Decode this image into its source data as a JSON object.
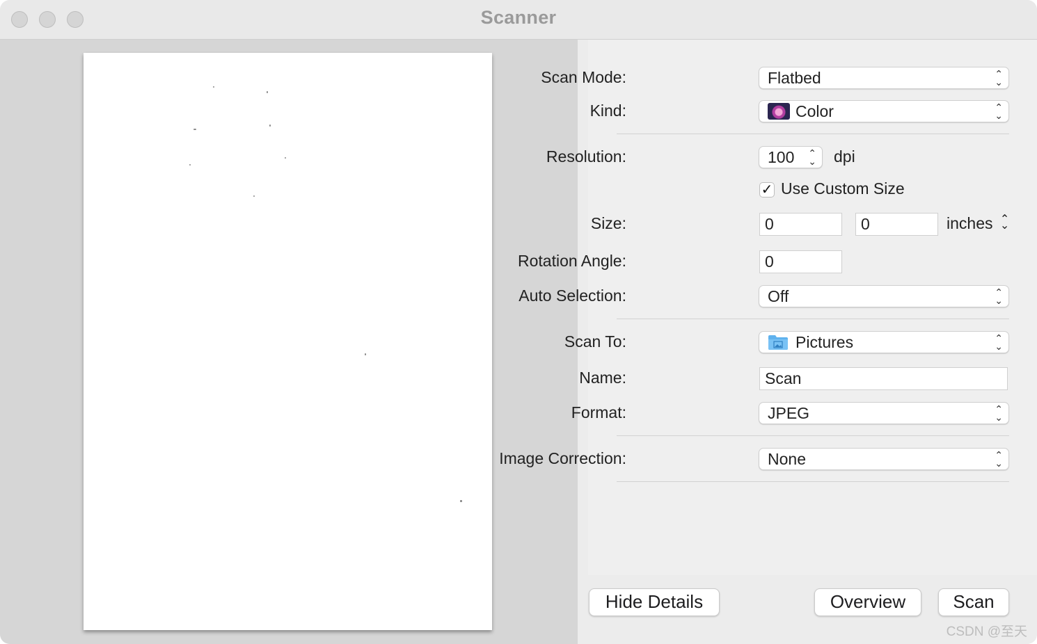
{
  "window": {
    "title": "Scanner"
  },
  "settings": {
    "scan_mode": {
      "label": "Scan Mode:",
      "value": "Flatbed"
    },
    "kind": {
      "label": "Kind:",
      "value": "Color",
      "icon": "color-flower-icon"
    },
    "resolution": {
      "label": "Resolution:",
      "value": "100",
      "unit": "dpi"
    },
    "use_custom_size": {
      "label": "Use Custom Size",
      "checked": true,
      "mark": "✓"
    },
    "size": {
      "label": "Size:",
      "width": "0",
      "height": "0",
      "unit": "inches"
    },
    "rotation_angle": {
      "label": "Rotation Angle:",
      "value": "0"
    },
    "auto_selection": {
      "label": "Auto Selection:",
      "value": "Off"
    },
    "scan_to": {
      "label": "Scan To:",
      "value": "Pictures",
      "icon": "pictures-folder-icon"
    },
    "name": {
      "label": "Name:",
      "value": "Scan"
    },
    "format": {
      "label": "Format:",
      "value": "JPEG"
    },
    "image_correction": {
      "label": "Image Correction:",
      "value": "None"
    }
  },
  "buttons": {
    "hide_details": "Hide Details",
    "overview": "Overview",
    "scan": "Scan"
  },
  "watermark": "CSDN @至天",
  "colors": {
    "preview_bg": "#d6d6d6",
    "panel_bg": "#efefef",
    "title_text": "#9a9a9a"
  }
}
